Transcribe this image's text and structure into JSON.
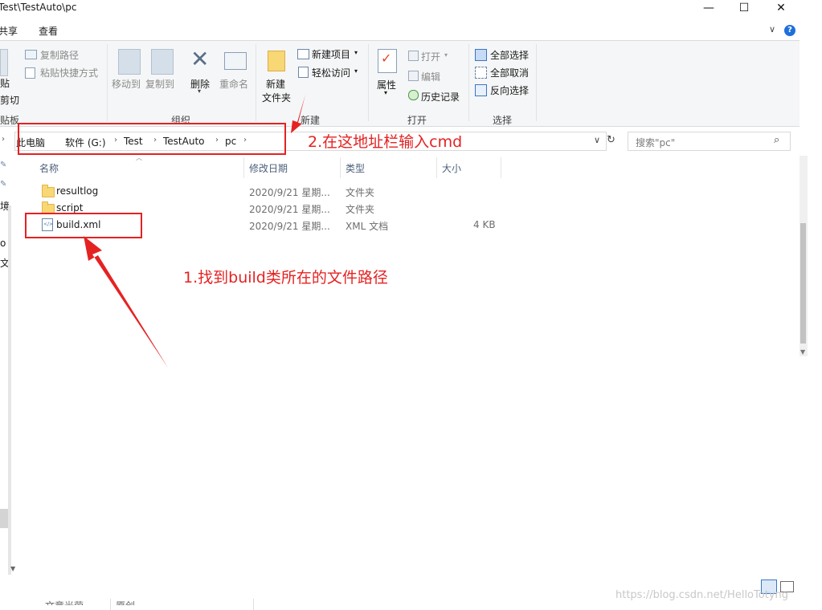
{
  "window": {
    "title": "Test\\TestAuto\\pc",
    "minimize": "—",
    "maximize": "☐",
    "close": "✕"
  },
  "menu": {
    "tabs": [
      "共享",
      "查看"
    ],
    "collapse": "∨",
    "help": "?"
  },
  "ribbon": {
    "clipboard": {
      "paste_partial": "贴",
      "cut_partial": "剪切",
      "copy_path": "复制路径",
      "paste_shortcut": "粘贴快捷方式",
      "group_label": "贴板"
    },
    "organize": {
      "move_to": "移动到",
      "copy_to": "复制到",
      "delete": "删除",
      "rename": "重命名",
      "group_label": "组织"
    },
    "new": {
      "new_folder_line1": "新建",
      "new_folder_line2": "文件夹",
      "new_item": "新建项目",
      "easy_access": "轻松访问",
      "group_label": "新建"
    },
    "open": {
      "properties": "属性",
      "open": "打开",
      "edit": "编辑",
      "history": "历史记录",
      "group_label": "打开"
    },
    "select": {
      "select_all": "全部选择",
      "select_none": "全部取消",
      "invert": "反向选择",
      "group_label": "选择"
    }
  },
  "address": {
    "crumbs": [
      "此电脑",
      "软件 (G:)",
      "Test",
      "TestAuto",
      "pc"
    ],
    "search_placeholder": "搜索\"pc\""
  },
  "columns": {
    "name": "名称",
    "modified": "修改日期",
    "type": "类型",
    "size": "大小"
  },
  "files": [
    {
      "name": "resultlog",
      "modified": "2020/9/21 星期...",
      "type": "文件夹",
      "size": ""
    },
    {
      "name": "script",
      "modified": "2020/9/21 星期...",
      "type": "文件夹",
      "size": ""
    },
    {
      "name": "build.xml",
      "modified": "2020/9/21 星期...",
      "type": "XML 文档",
      "size": "4 KB"
    }
  ],
  "navpane": {
    "partial1": "境",
    "partial2": "o",
    "partial3": "文"
  },
  "statusbar": {
    "partial_left": "文章光荣",
    "partial_mid": "原创"
  },
  "annotations": {
    "step1": "1.找到build类所在的文件路径",
    "step2": "2.在这地址栏输入cmd",
    "color": "#e52222"
  },
  "watermark": "https://blog.csdn.net/HelloTotyng"
}
